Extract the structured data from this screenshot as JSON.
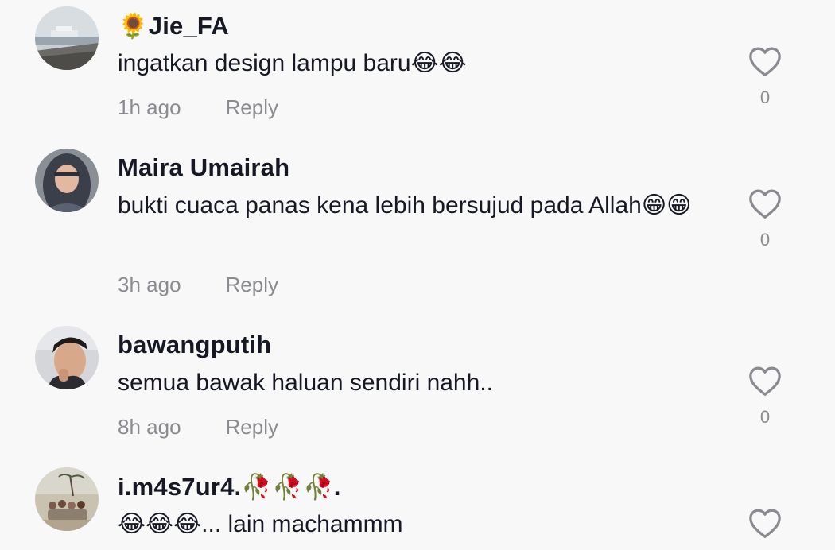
{
  "comments": [
    {
      "username": "🌻Jie_FA",
      "text": "ingatkan design lampu baru😂😂",
      "time": "1h ago",
      "reply_label": "Reply",
      "likes": "0",
      "avatar_icon": "ship-avatar"
    },
    {
      "username": "Maira Umairah",
      "text": "bukti cuaca panas kena lebih bersujud pada Allah😁😁",
      "time": "3h ago",
      "reply_label": "Reply",
      "likes": "0",
      "avatar_icon": "hijab-avatar"
    },
    {
      "username": "bawangputih",
      "text": "semua bawak haluan sendiri nahh..",
      "time": "8h ago",
      "reply_label": "Reply",
      "likes": "0",
      "avatar_icon": "man-avatar"
    },
    {
      "username": "i.m4s7ur4.🥀🥀🥀.",
      "text": "😂😂😂... lain machammm",
      "time": "",
      "reply_label": "",
      "likes": "",
      "avatar_icon": "group-beach-avatar"
    }
  ],
  "colors": {
    "background": "#f8f8f8",
    "username": "#161823",
    "meta": "#8a8b91",
    "heart": "#8a8b91"
  },
  "icons": {
    "like": "heart-outline-icon"
  }
}
